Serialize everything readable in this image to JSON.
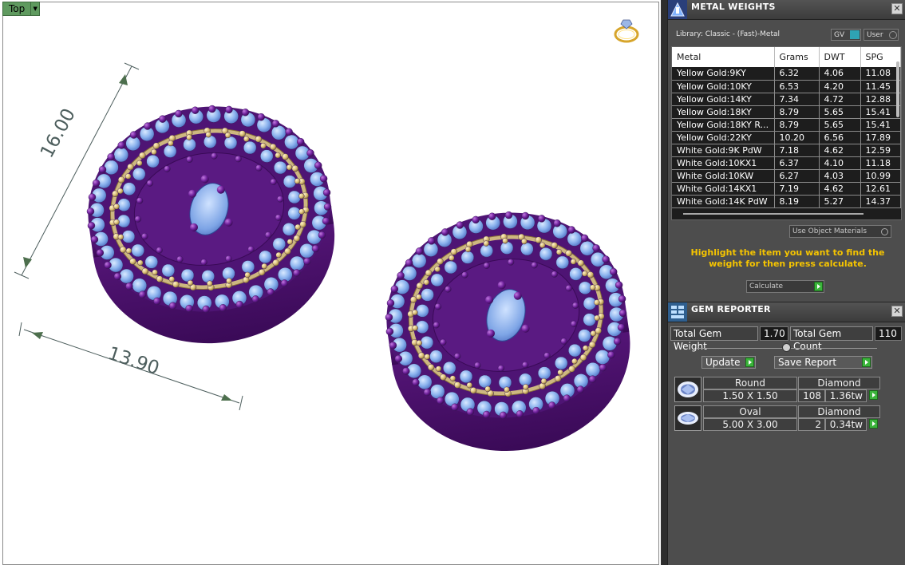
{
  "viewport": {
    "view_name": "Top",
    "dimensions": {
      "height": "16.00",
      "width": "13.90"
    }
  },
  "metal_weights": {
    "title": "METAL WEIGHTS",
    "library": "Library: Classic - (Fast)-Metal",
    "toggle_gv": "GV",
    "toggle_user": "User",
    "columns": [
      "Metal",
      "Grams",
      "DWT",
      "SPG"
    ],
    "rows": [
      [
        "Yellow Gold:9KY",
        "6.32",
        "4.06",
        "11.08"
      ],
      [
        "Yellow Gold:10KY",
        "6.53",
        "4.20",
        "11.45"
      ],
      [
        "Yellow Gold:14KY",
        "7.34",
        "4.72",
        "12.88"
      ],
      [
        "Yellow Gold:18KY",
        "8.79",
        "5.65",
        "15.41"
      ],
      [
        "Yellow Gold:18KY R...",
        "8.79",
        "5.65",
        "15.41"
      ],
      [
        "Yellow Gold:22KY",
        "10.20",
        "6.56",
        "17.89"
      ],
      [
        "White Gold:9K PdW",
        "7.18",
        "4.62",
        "12.59"
      ],
      [
        "White Gold:10KX1",
        "6.37",
        "4.10",
        "11.18"
      ],
      [
        "White Gold:10KW",
        "6.27",
        "4.03",
        "10.99"
      ],
      [
        "White Gold:14KX1",
        "7.19",
        "4.62",
        "12.61"
      ],
      [
        "White Gold:14K PdW",
        "8.19",
        "5.27",
        "14.37"
      ]
    ],
    "use_object_materials": "Use Object Materials",
    "hint": "Highlight the item you want to find the weight for then press calculate.",
    "calculate": "Calculate"
  },
  "gem_reporter": {
    "title": "GEM REPORTER",
    "total_weight_label": "Total Gem Weight",
    "total_weight": "1.70",
    "total_count_label": "Total Gem Count",
    "total_count": "110",
    "update": "Update",
    "save_report": "Save Report",
    "gems": [
      {
        "shape": "Round",
        "material": "Diamond",
        "size": "1.50 X 1.50",
        "count": "108",
        "weight": "1.36tw"
      },
      {
        "shape": "Oval",
        "material": "Diamond",
        "size": "5.00 X 3.00",
        "count": "2",
        "weight": "0.34tw"
      }
    ]
  }
}
